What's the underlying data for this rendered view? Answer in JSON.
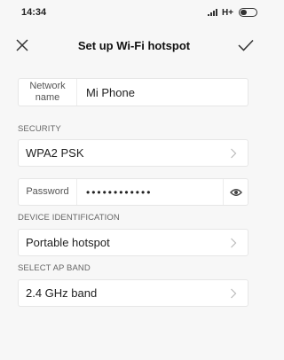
{
  "status_bar": {
    "time": "14:34",
    "network_type": "H+",
    "battery_level": 0.35
  },
  "header": {
    "title": "Set up Wi-Fi hotspot",
    "close_icon": "close-icon",
    "confirm_icon": "check-icon"
  },
  "network_name": {
    "label": "Network name",
    "value": "Mi Phone"
  },
  "security": {
    "section_label": "SECURITY",
    "value": "WPA2 PSK"
  },
  "password": {
    "label": "Password",
    "value": "••••••••••••",
    "toggle_icon": "eye-icon"
  },
  "device_identification": {
    "section_label": "DEVICE IDENTIFICATION",
    "value": "Portable hotspot"
  },
  "ap_band": {
    "section_label": "SELECT AP BAND",
    "value": "2.4 GHz band"
  },
  "colors": {
    "background": "#f7f7f7",
    "card": "#ffffff",
    "border": "#e6e6e6",
    "text": "#222222",
    "muted": "#666666"
  }
}
